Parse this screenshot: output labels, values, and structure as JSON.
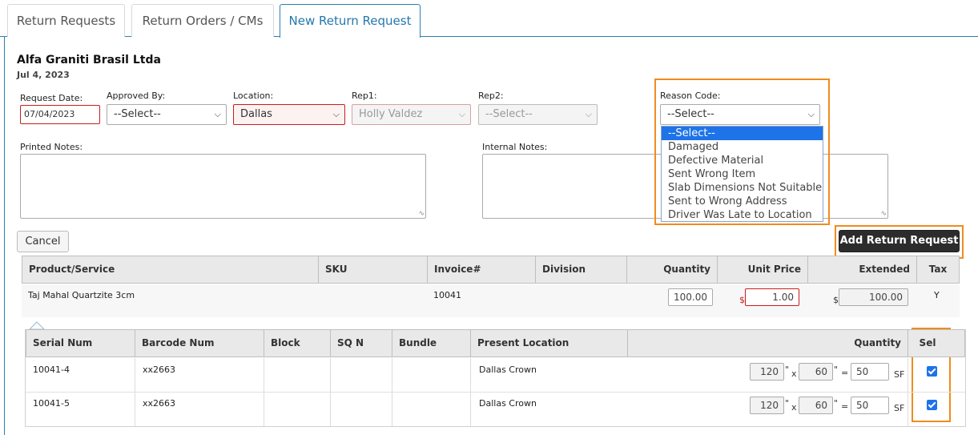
{
  "tabs": [
    "Return Requests",
    "Return Orders / CMs",
    "New Return Request"
  ],
  "header": {
    "company": "Alfa Graniti Brasil Ltda",
    "date": "Jul 4, 2023"
  },
  "form": {
    "request_date_label": "Request Date:",
    "request_date_value": "07/04/2023",
    "approved_by_label": "Approved By:",
    "approved_by_value": "--Select--",
    "location_label": "Location:",
    "location_value": "Dallas",
    "rep1_label": "Rep1:",
    "rep1_value": "Holly Valdez",
    "rep2_label": "Rep2:",
    "rep2_value": "--Select--",
    "reason_code_label": "Reason Code:",
    "reason_code_value": "--Select--",
    "reason_code_options": [
      "--Select--",
      "Damaged",
      "Defective Material",
      "Sent Wrong Item",
      "Slab Dimensions Not Suitable",
      "Sent to Wrong Address",
      "Driver Was Late to Location"
    ],
    "printed_notes_label": "Printed Notes:",
    "internal_notes_label": "Internal Notes:"
  },
  "buttons": {
    "cancel": "Cancel",
    "add": "Add Return Request"
  },
  "product_table": {
    "headers": [
      "Product/Service",
      "SKU",
      "Invoice#",
      "Division",
      "Quantity",
      "Unit Price",
      "Extended",
      "Tax"
    ],
    "row": {
      "product": "Taj Mahal Quartzite 3cm",
      "sku": "",
      "invoice": "10041",
      "division": "",
      "quantity": "100.00",
      "currency": "$",
      "unit_price": "1.00",
      "extended": "100.00",
      "tax": "Y"
    }
  },
  "slab_table": {
    "headers": [
      "Serial Num",
      "Barcode Num",
      "Block",
      "SQ N",
      "Bundle",
      "Present Location",
      "Quantity",
      "Sel"
    ],
    "rows": [
      {
        "serial": "10041-4",
        "barcode": "xx2663",
        "block": "",
        "sqn": "",
        "bundle": "",
        "location": "Dallas Crown",
        "w": "120",
        "h": "60",
        "area": "50",
        "unit": "SF",
        "selected": true
      },
      {
        "serial": "10041-5",
        "barcode": "xx2663",
        "block": "",
        "sqn": "",
        "bundle": "",
        "location": "Dallas Crown",
        "w": "120",
        "h": "60",
        "area": "50",
        "unit": "SF",
        "selected": true
      }
    ],
    "inch_mark": "\"",
    "times": "x",
    "equals": "="
  },
  "colors": {
    "accent": "#2e7fb0",
    "highlight": "#f08c1e",
    "error": "#c81e1e",
    "select_blue": "#1e73e8"
  }
}
